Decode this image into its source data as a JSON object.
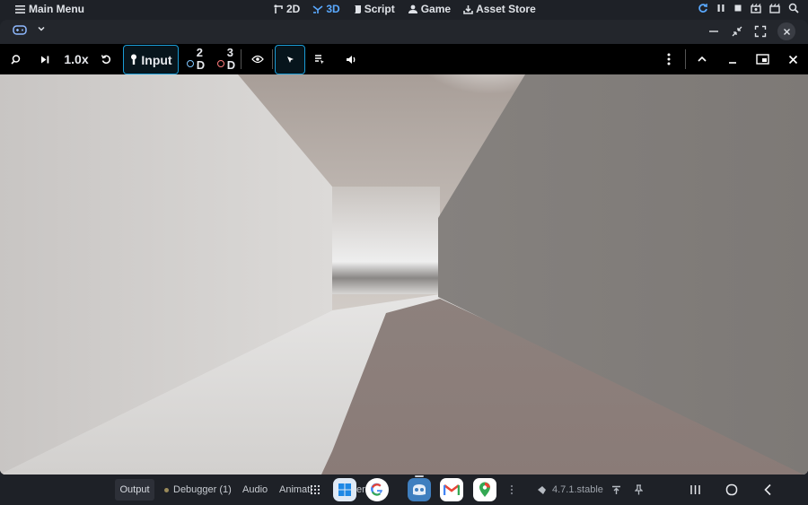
{
  "editor": {
    "main_menu_label": "Main Menu",
    "tabs": [
      {
        "label": "2D",
        "active": false
      },
      {
        "label": "3D",
        "active": true
      },
      {
        "label": "Script",
        "active": false
      },
      {
        "label": "Game",
        "active": false
      },
      {
        "label": "Asset Store",
        "active": false
      }
    ]
  },
  "toolbar": {
    "speed": "1.0x",
    "input_label": "Input",
    "mode_2d_num": "2",
    "mode_2d_letter": "D",
    "mode_3d_num": "3",
    "mode_3d_letter": "D"
  },
  "bottom": {
    "output_label": "Output",
    "debugger_label": "Debugger (1)",
    "audio_label": "Audio",
    "animation_label": "Animati",
    "partial_label": "er",
    "version": "4.7.1.stable"
  },
  "colors": {
    "accent": "#5aa9ff",
    "selected_border": "#1a9cd6",
    "mode2d_ring": "#7fc6ff",
    "mode3d_ring": "#ff7b7b"
  }
}
